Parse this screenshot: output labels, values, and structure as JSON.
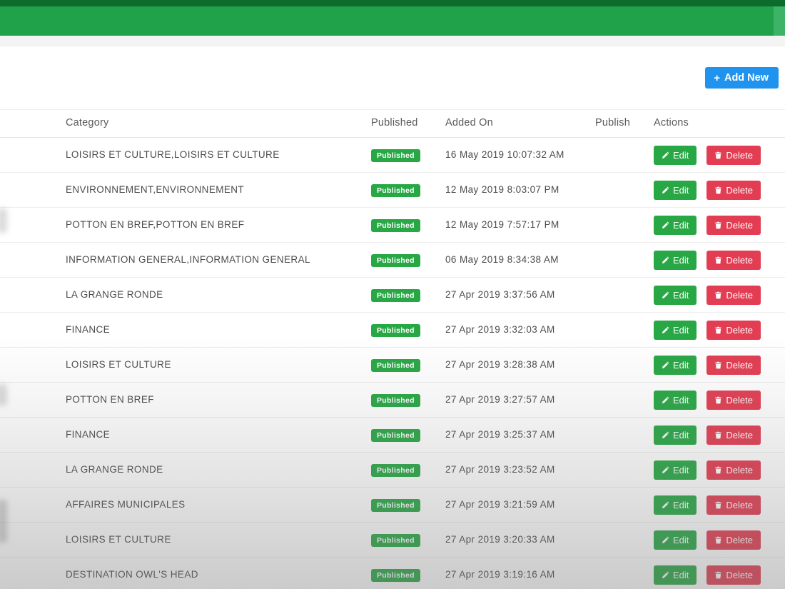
{
  "toolbar": {
    "add_new_label": "Add New",
    "add_new_color": "#2093ee"
  },
  "table": {
    "columns": {
      "category": "Category",
      "published": "Published",
      "added_on": "Added On",
      "publish": "Publish",
      "actions": "Actions"
    },
    "badge_label": "Published",
    "edit_label": "Edit",
    "delete_label": "Delete",
    "rows": [
      {
        "category": "LOISIRS ET CULTURE,LOISIRS ET CULTURE",
        "status": "Published",
        "added_on": "16 May 2019 10:07:32 AM"
      },
      {
        "category": "ENVIRONNEMENT,ENVIRONNEMENT",
        "status": "Published",
        "added_on": "12 May 2019 8:03:07 PM"
      },
      {
        "category": "POTTON EN BREF,POTTON EN BREF",
        "status": "Published",
        "added_on": "12 May 2019 7:57:17 PM"
      },
      {
        "category": "INFORMATION GENERAL,INFORMATION GENERAL",
        "status": "Published",
        "added_on": "06 May 2019 8:34:38 AM"
      },
      {
        "category": "LA GRANGE RONDE",
        "status": "Published",
        "added_on": "27 Apr 2019 3:37:56 AM"
      },
      {
        "category": "FINANCE",
        "status": "Published",
        "added_on": "27 Apr 2019 3:32:03 AM"
      },
      {
        "category": "LOISIRS ET CULTURE",
        "status": "Published",
        "added_on": "27 Apr 2019 3:28:38 AM"
      },
      {
        "category": "POTTON EN BREF",
        "status": "Published",
        "added_on": "27 Apr 2019 3:27:57 AM"
      },
      {
        "category": "FINANCE",
        "status": "Published",
        "added_on": "27 Apr 2019 3:25:37 AM"
      },
      {
        "category": "LA GRANGE RONDE",
        "status": "Published",
        "added_on": "27 Apr 2019 3:23:52 AM"
      },
      {
        "category": "AFFAIRES MUNICIPALES",
        "status": "Published",
        "added_on": "27 Apr 2019 3:21:59 AM"
      },
      {
        "category": "LOISIRS ET CULTURE",
        "status": "Published",
        "added_on": "27 Apr 2019 3:20:33 AM"
      },
      {
        "category": "DESTINATION OWL'S HEAD",
        "status": "Published",
        "added_on": "27 Apr 2019 3:19:16 AM"
      }
    ]
  },
  "colors": {
    "header_green": "#1fa24a",
    "header_dark_green": "#0d6b2c",
    "badge_green": "#28a745",
    "edit_green": "#28a745",
    "delete_red": "#e23d52",
    "add_new_blue": "#2093ee"
  }
}
